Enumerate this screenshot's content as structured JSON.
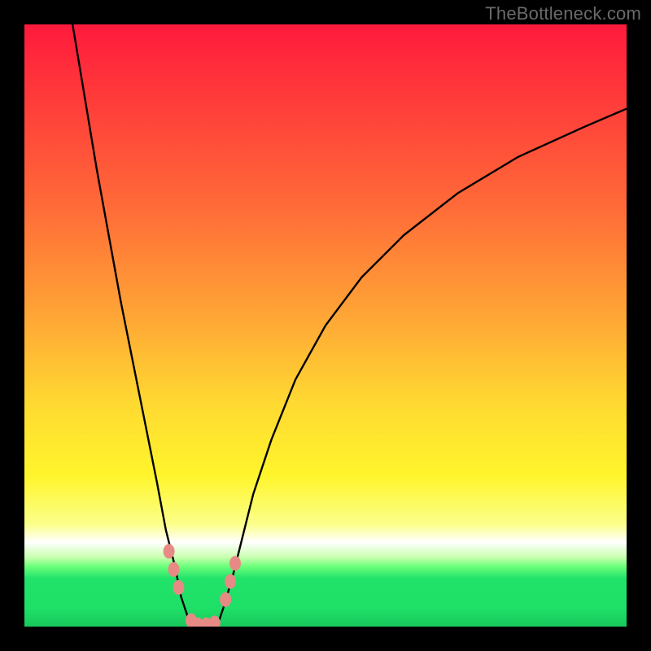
{
  "watermark": "TheBottleneck.com",
  "chart_data": {
    "type": "line",
    "title": "",
    "xlabel": "",
    "ylabel": "",
    "xlim": [
      0,
      100
    ],
    "ylim": [
      0,
      100
    ],
    "grid": false,
    "legend": false,
    "gradient_stops": [
      {
        "pos": 0,
        "color": "#ff1a3c"
      },
      {
        "pos": 12,
        "color": "#ff3a3a"
      },
      {
        "pos": 30,
        "color": "#ff6a38"
      },
      {
        "pos": 48,
        "color": "#ffa436"
      },
      {
        "pos": 63,
        "color": "#ffd931"
      },
      {
        "pos": 75,
        "color": "#fff52c"
      },
      {
        "pos": 83,
        "color": "#fbff8a"
      },
      {
        "pos": 86,
        "color": "#ffffff"
      },
      {
        "pos": 88.5,
        "color": "#c9ffb0"
      },
      {
        "pos": 90,
        "color": "#6cff7a"
      },
      {
        "pos": 92,
        "color": "#21e36a"
      },
      {
        "pos": 97,
        "color": "#1ee067"
      },
      {
        "pos": 100,
        "color": "#18c85c"
      }
    ],
    "series": [
      {
        "name": "left-branch",
        "x": [
          8,
          10,
          12,
          14,
          16,
          18,
          20,
          22,
          23.5,
          25,
          26,
          27,
          27.8
        ],
        "y": [
          100,
          88,
          76,
          65,
          54,
          44,
          34,
          24,
          16,
          10,
          5,
          2,
          0
        ]
      },
      {
        "name": "flat-bottom",
        "x": [
          27.8,
          29,
          30,
          31,
          32
        ],
        "y": [
          0,
          0,
          0,
          0,
          0
        ]
      },
      {
        "name": "right-branch",
        "x": [
          32,
          33,
          34.5,
          36,
          38,
          41,
          45,
          50,
          56,
          63,
          72,
          82,
          93,
          100
        ],
        "y": [
          0,
          3,
          8,
          14,
          22,
          31,
          41,
          50,
          58,
          65,
          72,
          78,
          83,
          86
        ]
      }
    ],
    "markers": [
      {
        "x": 24.0,
        "y": 12.5
      },
      {
        "x": 24.8,
        "y": 9.5
      },
      {
        "x": 25.6,
        "y": 6.5
      },
      {
        "x": 27.7,
        "y": 1.0
      },
      {
        "x": 28.8,
        "y": 0.3
      },
      {
        "x": 30.2,
        "y": 0.3
      },
      {
        "x": 31.6,
        "y": 0.6
      },
      {
        "x": 33.4,
        "y": 4.5
      },
      {
        "x": 34.2,
        "y": 7.5
      },
      {
        "x": 35.0,
        "y": 10.5
      }
    ]
  }
}
